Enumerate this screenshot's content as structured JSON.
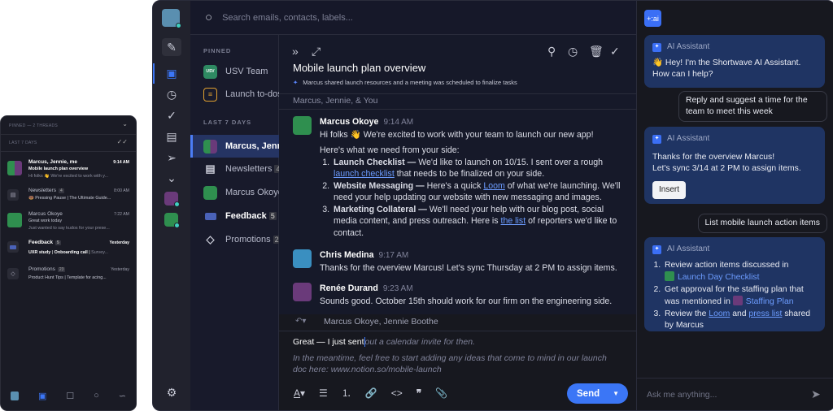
{
  "mobile": {
    "pinned_header": "PINNED — 2 THREADS",
    "recent_header": "LAST 7 DAYS",
    "threads": [
      {
        "title": "Marcus, Jennie, me",
        "time": "9:14 AM",
        "subject": "Mobile launch plan overview",
        "preview": "Hi folks 👋 We're excited to work with y...",
        "unread": true
      },
      {
        "title": "Newsletters",
        "count": "4",
        "time": "8:00 AM",
        "preview": "🍩 Pressing Pause | The Ultimate Guide..."
      },
      {
        "title": "Marcus Okoye",
        "time": "7:22 AM",
        "subject": "Great work today",
        "preview": "Just wanted to say kudos for your prese..."
      },
      {
        "title": "Feedback",
        "count": "5",
        "time": "Yesterday",
        "preview_bold1": "UXR study",
        "preview_bold2": "Onboarding call",
        "preview": "Survey..."
      },
      {
        "title": "Promotions",
        "count": "23",
        "time": "Yesterday",
        "preview": "Product Hunt Tips | Template for acing..."
      }
    ],
    "nav": [
      "profile",
      "inbox",
      "compose",
      "search",
      "waves"
    ]
  },
  "search": {
    "placeholder": "Search emails, contacts, labels..."
  },
  "sidebar": {
    "pinned_header": "PINNED",
    "recent_header": "LAST 7 DAYS",
    "pinned": [
      {
        "label": "USV Team",
        "avatar": "USV"
      },
      {
        "label": "Launch to-dos"
      }
    ],
    "items": [
      {
        "label": "Marcus, Jennie, me"
      },
      {
        "label": "Newsletters",
        "count": "4"
      },
      {
        "label": "Marcus Okoye"
      },
      {
        "label": "Feedback",
        "count": "5"
      },
      {
        "label": "Promotions",
        "count": "23"
      }
    ]
  },
  "thread": {
    "title": "Mobile launch plan overview",
    "summary": "Marcus shared launch resources and a meeting was scheduled to finalize tasks",
    "participants": "Marcus, Jennie, & You",
    "messages": [
      {
        "author": "Marcus Okoye",
        "time": "9:14 AM",
        "greeting": "Hi folks 👋 We're excited to work with your team to launch our new app!",
        "intro": "Here's what we need from your side:",
        "items": [
          {
            "bold": "Launch Checklist —",
            "pre": " We'd like to launch on 10/15. I sent over a rough ",
            "link": "launch checklist",
            "post": " that needs to be finalized on your side."
          },
          {
            "bold": "Website Messaging —",
            "pre": " Here's a quick ",
            "link": "Loom",
            "post": " of what we're launching. We'll need your help updating our website with new messaging and images."
          },
          {
            "bold": "Marketing Collateral —",
            "pre": " We'll need your help with our blog post, social media content, and press outreach. Here is ",
            "link": "the list",
            "post": " of reporters we'd like to contact."
          }
        ]
      },
      {
        "author": "Chris Medina",
        "time": "9:17 AM",
        "text": "Thanks for the overview Marcus! Let's sync Thursday at 2 PM to assign items."
      },
      {
        "author": "Renée Durand",
        "time": "9:23 AM",
        "text": "Sounds good. October 15th should work for our firm on the engineering side."
      }
    ],
    "reply": {
      "recipients": "Marcus Okoye, Jennie Boothe",
      "typed": "Great — I just sent",
      "suggestion": "out a calendar invite for then.",
      "suggestion2": "In the meantime, feel free to start adding any ideas that come to mind in our launch doc here: www.notion.so/mobile-launch",
      "send_label": "Send"
    }
  },
  "ai": {
    "logo": "+:ai",
    "assistant_label": "AI Assistant",
    "m1": "👋 Hey! I'm the Shortwave AI Assistant. How can I help?",
    "u1": "Reply and suggest a time for the team to meet this week",
    "m2a": "Thanks for the overview Marcus!",
    "m2b": "Let's sync 3/14 at 2 PM to assign items.",
    "insert_label": "Insert",
    "u2": "List mobile launch action items",
    "m3": {
      "i1": "Review action items discussed in",
      "i1link": "Launch Day Checklist",
      "i2": "Get approval for the staffing plan that was mentioned in",
      "i2link": "Staffing Plan",
      "i3a": "Review the",
      "i3l1": "Loom",
      "i3b": "and",
      "i3l2": "press list",
      "i3c": "shared by Marcus"
    },
    "input_placeholder": "Ask me anything..."
  },
  "colors": {
    "accent": "#3b76f6",
    "selected": "#253463",
    "ai_bubble": "#1f3463"
  }
}
